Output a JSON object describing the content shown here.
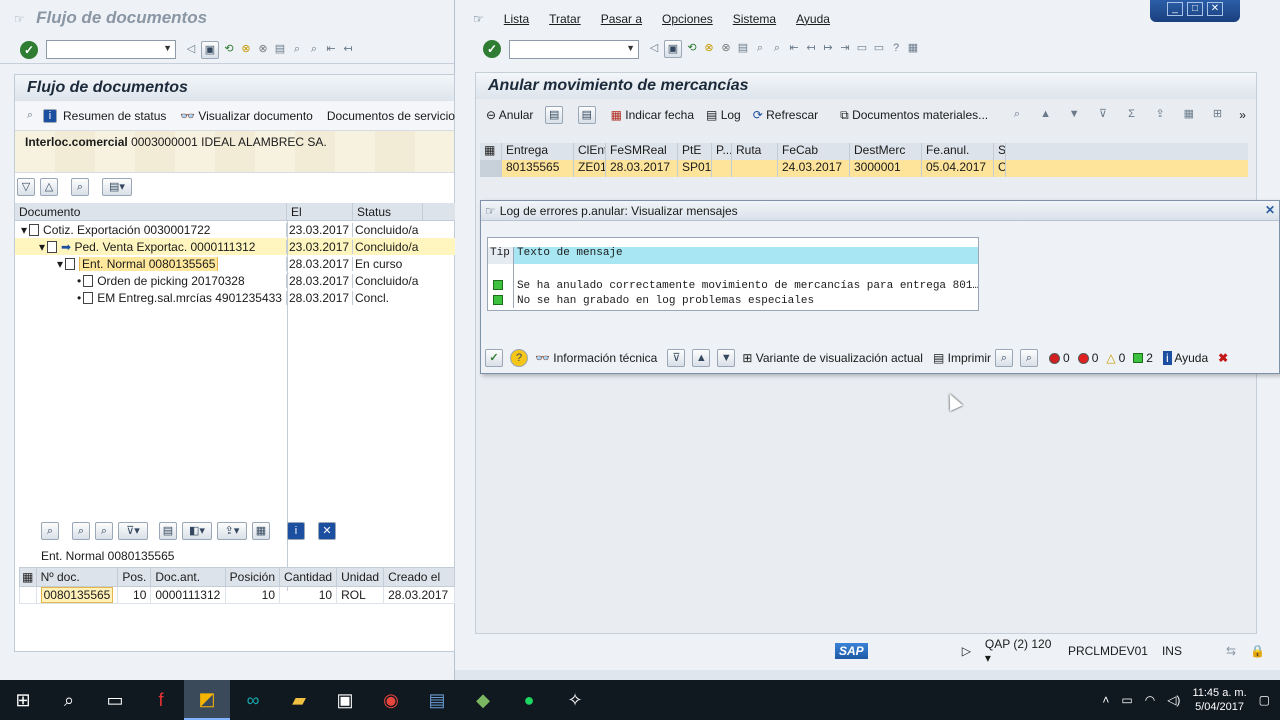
{
  "left_window": {
    "title": "Flujo de documentos",
    "page_title": "Flujo de documentos",
    "app_toolbar": {
      "status_overview": "Resumen de status",
      "display_document": "Visualizar documento",
      "service_documents": "Documentos de servicio"
    },
    "partner": {
      "label": "Interloc.comercial",
      "value": "0003000001 IDEAL ALAMBREC SA."
    },
    "tree": {
      "headers": [
        "Documento",
        "El",
        "Status"
      ],
      "rows": [
        {
          "doc": "Cotiz. Exportación 0030001722",
          "date": "23.03.2017",
          "status": "Concluido/a"
        },
        {
          "doc": "Ped. Venta Exportac. 0000111312",
          "date": "23.03.2017",
          "status": "Concluido/a"
        },
        {
          "doc": "Ent. Normal 0080135565",
          "date": "28.03.2017",
          "status": "En curso"
        },
        {
          "doc": "Orden de picking 20170328",
          "date": "28.03.2017",
          "status": "Concluido/a"
        },
        {
          "doc": "EM Entreg.sal.mrcías 4901235433",
          "date": "28.03.2017",
          "status": "Concl."
        }
      ]
    },
    "detail": {
      "title": "Ent. Normal 0080135565",
      "headers": [
        "Nº doc.",
        "Pos.",
        "Doc.ant.",
        "Posición",
        "Cantidad",
        "Unidad",
        "Creado el"
      ],
      "row": [
        "0080135565",
        "10",
        "0000111312",
        "10",
        "10",
        "ROL",
        "28.03.2017"
      ]
    }
  },
  "right_window": {
    "menu": [
      "Lista",
      "Tratar",
      "Pasar a",
      "Opciones",
      "Sistema",
      "Ayuda"
    ],
    "page_title": "Anular movimiento de mercancías",
    "app_toolbar": {
      "cancel": "Anular",
      "set_date": "Indicar fecha",
      "log": "Log",
      "refresh": "Refrescar",
      "material_docs": "Documentos materiales..."
    },
    "grid": {
      "headers": [
        "Entrega",
        "ClEnt",
        "FeSMReal",
        "PtE",
        "P...",
        "Ruta",
        "FeCab",
        "DestMerc",
        "Fe.anul.",
        "S"
      ],
      "row": [
        "80135565",
        "ZE01",
        "28.03.2017",
        "SP01",
        "",
        "",
        "24.03.2017",
        "3000001",
        "05.04.2017",
        "C"
      ]
    },
    "status_bar": {
      "system": "QAP (2) 120",
      "server": "PRCLMDEV01",
      "mode": "INS"
    }
  },
  "dialog": {
    "title": "Log de errores p.anular: Visualizar mensajes",
    "col_type": "Tip",
    "col_text": "Texto de mensaje",
    "messages": [
      "Se ha anulado correctamente movimiento de mercancías para entrega 801…",
      "No se han grabado en log problemas especiales"
    ],
    "toolbar": {
      "tech_info": "Información técnica",
      "layout": "Variante de visualización actual",
      "print": "Imprimir",
      "count_stop": "0",
      "count_error": "0",
      "count_warning": "0",
      "count_success": "2",
      "help": "Ayuda"
    }
  },
  "taskbar": {
    "time": "11:45 a. m.",
    "date": "5/04/2017"
  }
}
